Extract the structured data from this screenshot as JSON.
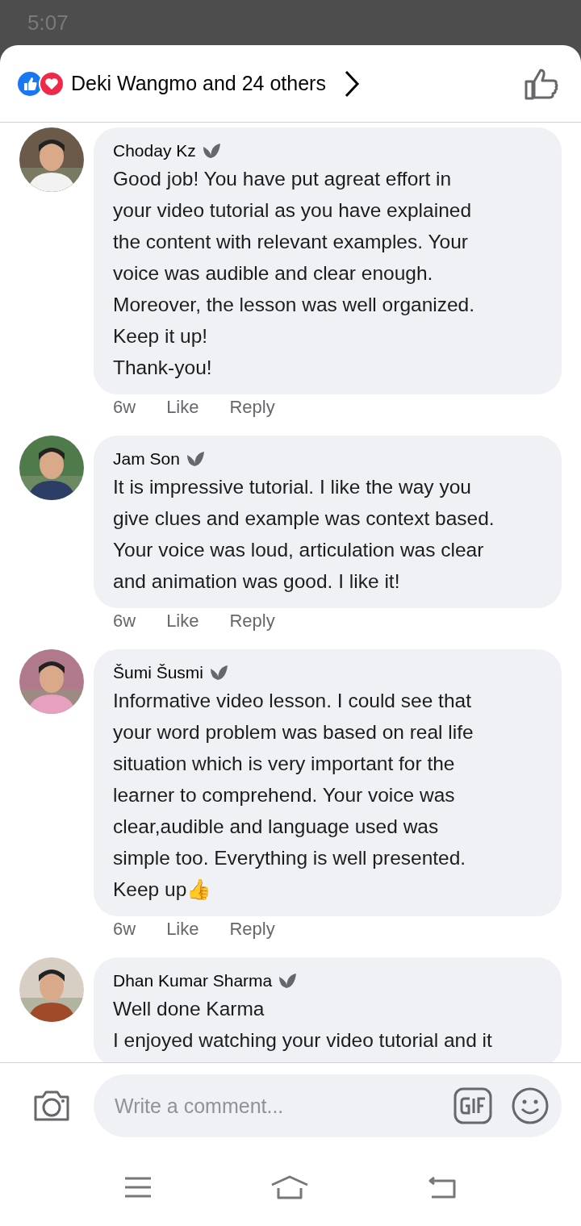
{
  "status_bar": {
    "time": "5:07"
  },
  "reactions": {
    "summary": "Deki Wangmo and 24 others"
  },
  "comments": [
    {
      "author": "Choday Kz",
      "text": "Good job!  You have put agreat effort in\nyour video tutorial as you have explained\nthe content with relevant examples. Your\nvoice was audible and clear enough.\nMoreover,  the lesson was well organized.\nKeep it up!\nThank-you!",
      "time": "6w",
      "actions": [
        "Like",
        "Reply"
      ]
    },
    {
      "author": "Jam Son",
      "text": "It is impressive tutorial. I like the way you\ngive clues and example was context based.\nYour voice was loud, articulation was clear\nand animation was good. I like it!",
      "time": "6w",
      "actions": [
        "Like",
        "Reply"
      ]
    },
    {
      "author": "Šumi Šusmi",
      "text": "Informative video lesson. I could see that\nyour word problem was based on real life\nsituation which is very important for the\nlearner to comprehend. Your voice was\nclear,audible and language used was\nsimple too. Everything is well presented.\nKeep up👍",
      "time": "6w",
      "actions": [
        "Like",
        "Reply"
      ]
    },
    {
      "author": "Dhan Kumar Sharma",
      "text": "Well done Karma\nI enjoyed watching your video tutorial and it"
    }
  ],
  "composer": {
    "placeholder": "Write a comment..."
  }
}
